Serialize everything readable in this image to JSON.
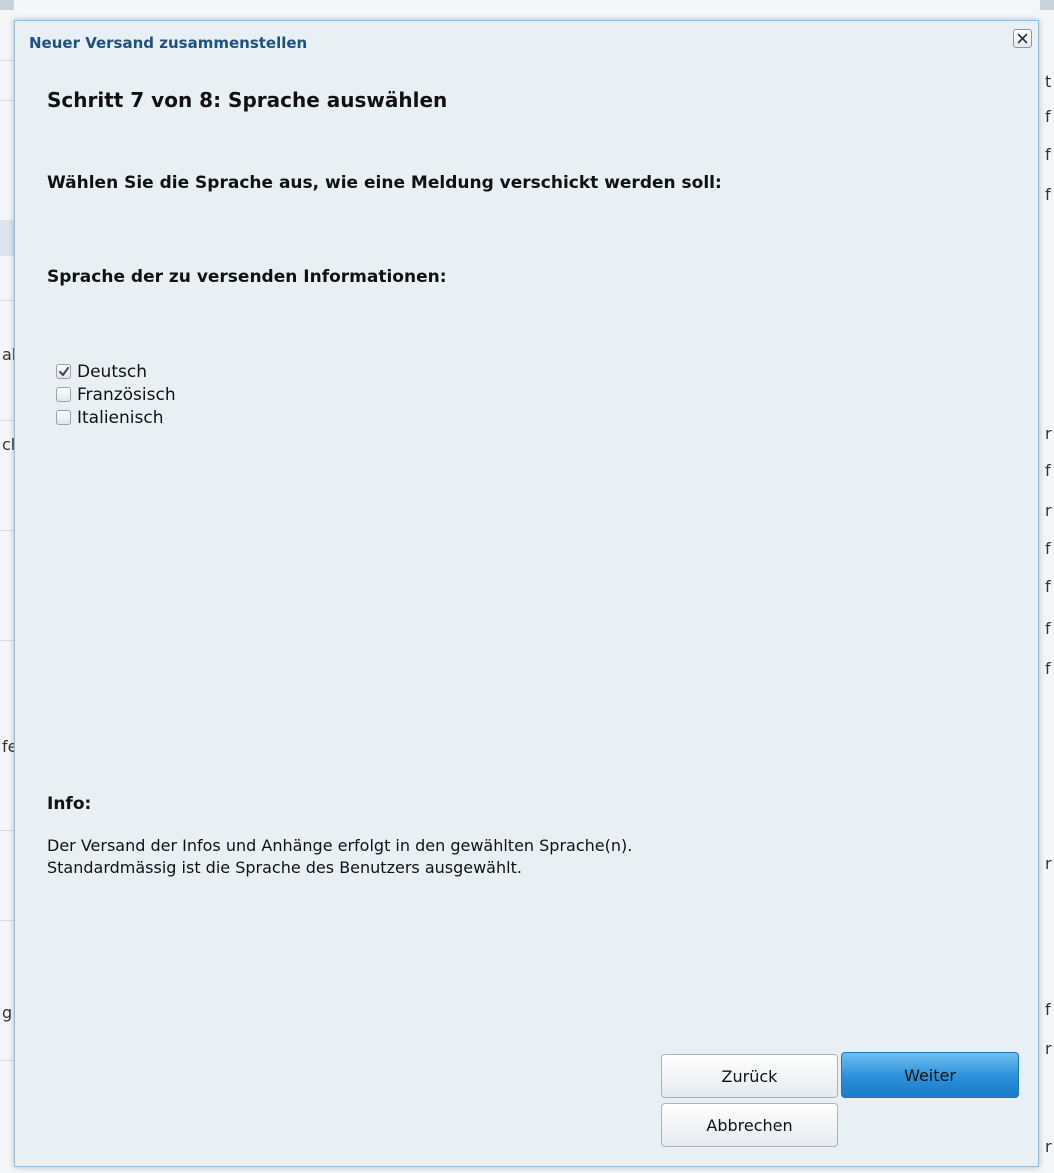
{
  "dialog": {
    "title": "Neuer Versand zusammenstellen",
    "step_title": "Schritt 7 von 8: Sprache auswählen",
    "prompt": "Wählen Sie die Sprache aus, wie eine Meldung verschickt werden soll:",
    "section_label": "Sprache der zu versenden Informationen:",
    "languages": [
      {
        "label": "Deutsch",
        "checked": true
      },
      {
        "label": "Französisch",
        "checked": false
      },
      {
        "label": "Italienisch",
        "checked": false
      }
    ],
    "info_heading": "Info:",
    "info_lines": [
      "Der Versand der Infos und Anhänge erfolgt in den gewählten Sprache(n).",
      "Standardmässig ist die Sprache des Benutzers ausgewählt."
    ],
    "buttons": {
      "back": "Zurück",
      "next": "Weiter",
      "cancel": "Abbrechen"
    }
  },
  "background": {
    "left_fragments": [
      "al",
      "cl",
      "fe",
      "g"
    ],
    "right_fragments": [
      "t",
      "f",
      "f",
      "f",
      "r",
      "f",
      "r",
      "f",
      "f",
      "f",
      "f",
      "r",
      "f",
      "r",
      "r"
    ]
  },
  "colors": {
    "dialog_bg": "#e9f0f4",
    "title_color": "#1e4f88",
    "primary_button": "#2b8fd9"
  }
}
